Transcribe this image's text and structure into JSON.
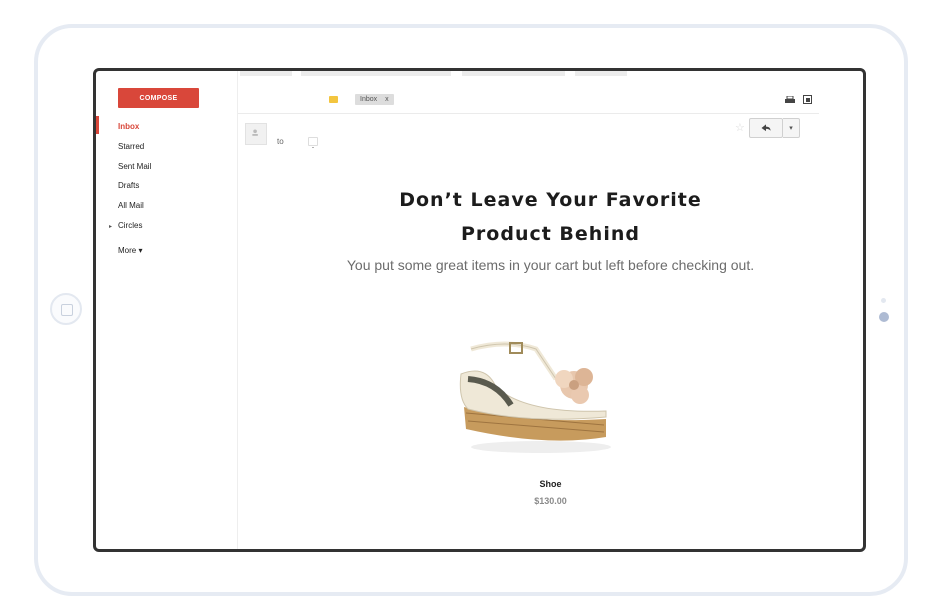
{
  "sidebar": {
    "compose_label": "COMPOSE",
    "items": [
      {
        "label": "Inbox"
      },
      {
        "label": "Starred"
      },
      {
        "label": "Sent Mail"
      },
      {
        "label": "Drafts"
      },
      {
        "label": "All Mail"
      },
      {
        "label": "Circles"
      },
      {
        "label": "More ▾"
      }
    ]
  },
  "toolbar": {
    "label_chip": "Inbox",
    "label_chip_remove": "x",
    "icons": [
      "folder-icon",
      "print-icon",
      "popout-icon"
    ]
  },
  "message": {
    "to_label": "to",
    "headline_line1": "Don’t Leave Your Favorite",
    "headline_line2": "Product Behind",
    "subtext": "You put some great items in your cart but left before checking out.",
    "product": {
      "name": "Shoe",
      "price": "$130.00"
    }
  },
  "colors": {
    "compose": "#d9473a",
    "active_nav": "#d9473a",
    "frame": "#333333",
    "tablet_border": "#e6ebf3"
  }
}
